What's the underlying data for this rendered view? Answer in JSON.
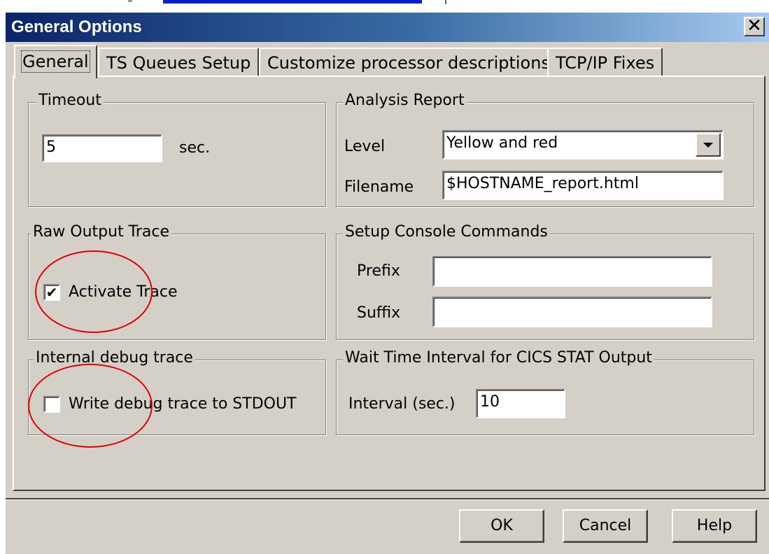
{
  "window": {
    "title": "General Options",
    "close_glyph": "✕"
  },
  "tabs": [
    {
      "label": "General",
      "active": true
    },
    {
      "label": "TS Queues Setup",
      "active": false
    },
    {
      "label": "Customize processor descriptions",
      "active": false
    },
    {
      "label": "TCP/IP Fixes",
      "active": false
    }
  ],
  "timeout": {
    "legend": "Timeout",
    "value": "5",
    "unit": "sec."
  },
  "analysis_report": {
    "legend": "Analysis Report",
    "level_label": "Level",
    "level_value": "Yellow and red",
    "filename_label": "Filename",
    "filename_value": "$HOSTNAME_report.html"
  },
  "raw_output_trace": {
    "legend": "Raw Output Trace",
    "checkbox_label": "Activate Trace",
    "checked": true,
    "check_glyph": "✔"
  },
  "console_commands": {
    "legend": "Setup Console Commands",
    "prefix_label": "Prefix",
    "prefix_value": "",
    "suffix_label": "Suffix",
    "suffix_value": ""
  },
  "internal_debug": {
    "legend": "Internal debug trace",
    "checkbox_label": "Write debug trace to STDOUT",
    "checked": false
  },
  "wait_time": {
    "legend": "Wait Time Interval for CICS STAT Output",
    "interval_label": "Interval (sec.)",
    "interval_value": "10"
  },
  "buttons": {
    "ok": "OK",
    "cancel": "Cancel",
    "help": "Help"
  },
  "annotation_color": "#e00000",
  "icons": {
    "close": "close-icon",
    "dropdown": "chevron-down-icon"
  }
}
